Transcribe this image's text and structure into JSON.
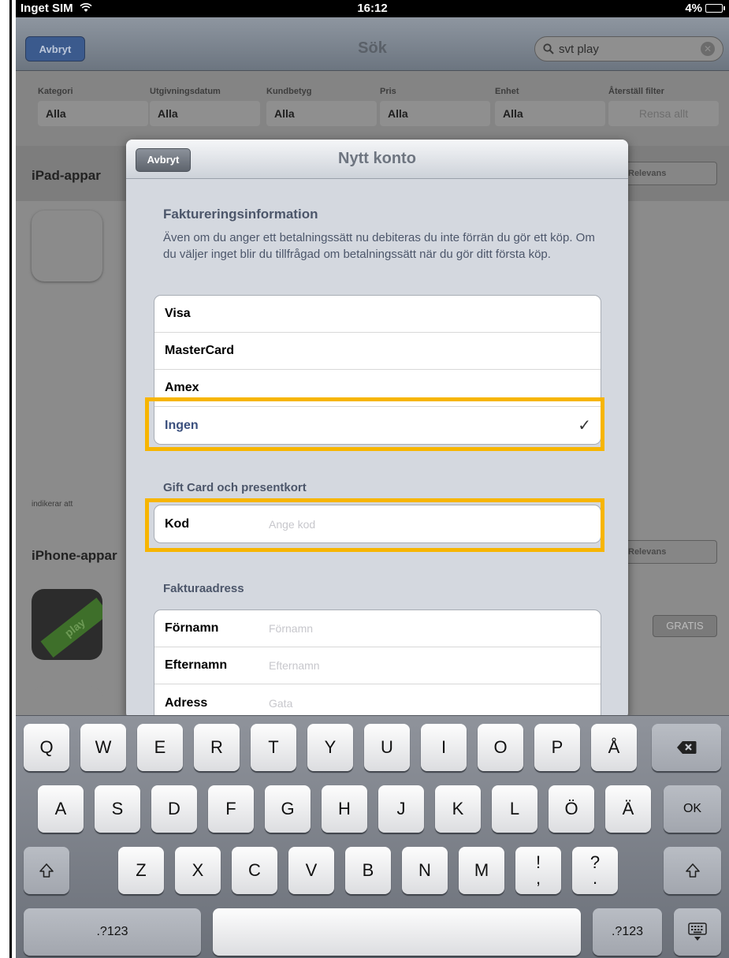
{
  "status": {
    "carrier": "Inget SIM",
    "time": "16:12",
    "battery": "4%"
  },
  "bg": {
    "nav": {
      "cancel": "Avbryt",
      "title": "Sök",
      "search_value": "svt play"
    },
    "filters": [
      {
        "label": "Kategori",
        "value": "Alla"
      },
      {
        "label": "Utgivningsdatum",
        "value": "Alla"
      },
      {
        "label": "Kundbetyg",
        "value": "Alla"
      },
      {
        "label": "Pris",
        "value": "Alla"
      },
      {
        "label": "Enhet",
        "value": "Alla"
      },
      {
        "label": "Återställ filter",
        "value": "Rensa allt"
      }
    ],
    "section1": "iPad-appar",
    "relevance": "Relevans",
    "note": "indikerar att",
    "section2": "iPhone-appar",
    "price": "GRATIS",
    "app_icon_text": "play"
  },
  "modal": {
    "cancel": "Avbryt",
    "title": "Nytt konto",
    "billing_title": "Faktureringsinformation",
    "billing_desc": "Även om du anger ett betalningssätt nu debiteras du inte förrän du gör ett köp. Om du väljer inget blir du tillfrågad om betalningssätt när du gör ditt första köp.",
    "payment_options": [
      "Visa",
      "MasterCard",
      "Amex",
      "Ingen"
    ],
    "checkmark": "✓",
    "gift_title": "Gift Card och presentkort",
    "code_label": "Kod",
    "code_placeholder": "Ange kod",
    "address_title": "Fakturaadress",
    "address_fields": [
      {
        "label": "Förnamn",
        "placeholder": "Förnamn"
      },
      {
        "label": "Efternamn",
        "placeholder": "Efternamn"
      },
      {
        "label": "Adress",
        "placeholder": "Gata"
      }
    ]
  },
  "keyboard": {
    "row1": [
      "Q",
      "W",
      "E",
      "R",
      "T",
      "Y",
      "U",
      "I",
      "O",
      "P",
      "Å"
    ],
    "row2": [
      "A",
      "S",
      "D",
      "F",
      "G",
      "H",
      "J",
      "K",
      "L",
      "Ö",
      "Ä"
    ],
    "row3": [
      "Z",
      "X",
      "C",
      "V",
      "B",
      "N",
      "M"
    ],
    "excl": [
      "!",
      ","
    ],
    "quest": [
      "?",
      "."
    ],
    "ok": "OK",
    "numbers": ".?123",
    "backspace_icon": "backspace-icon",
    "shift_icon": "shift-icon",
    "hide_icon": "keyboard-hide-icon"
  }
}
